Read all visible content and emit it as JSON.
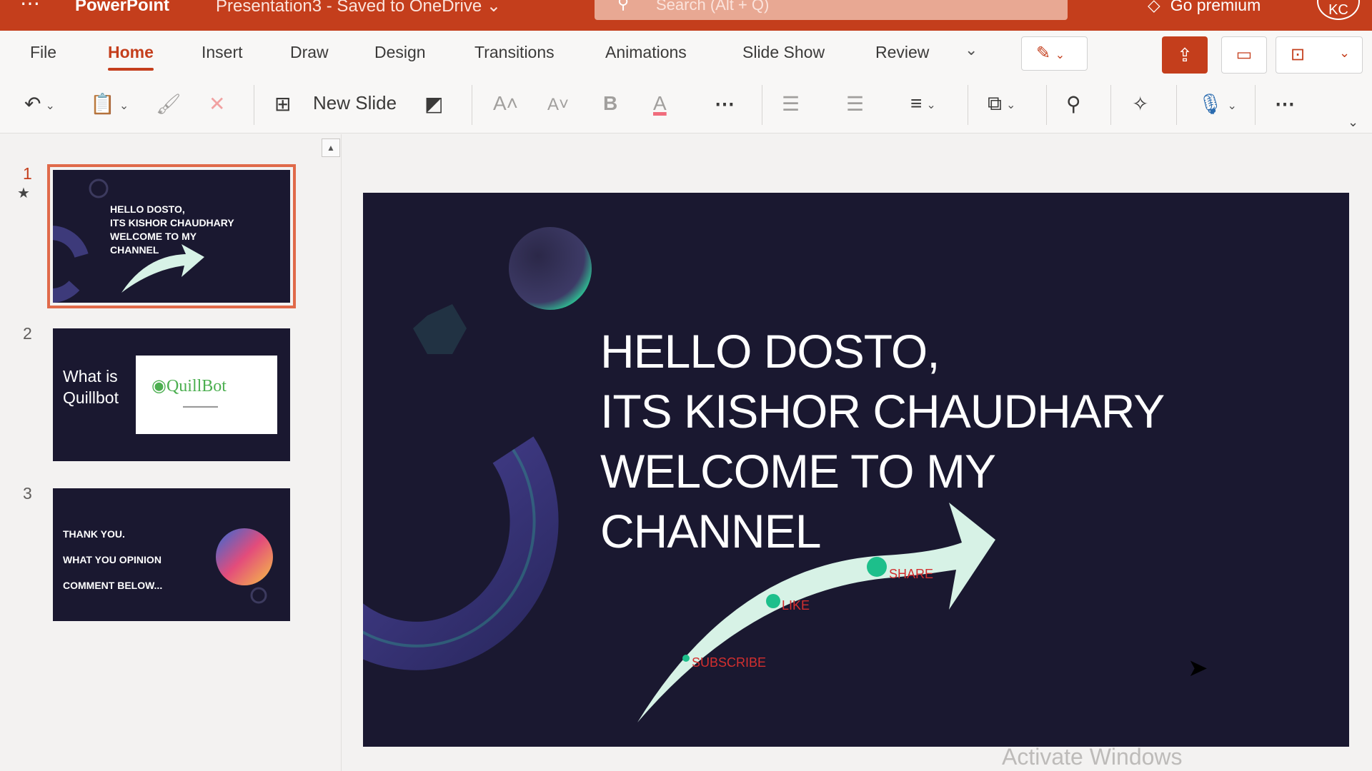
{
  "titlebar": {
    "app_name": "PowerPoint",
    "document_name": "Presentation3 - Saved to OneDrive",
    "search_placeholder": "Search (Alt + Q)",
    "go_premium": "Go premium",
    "avatar_initials": "KC"
  },
  "ribbon": {
    "tabs": [
      "File",
      "Home",
      "Insert",
      "Draw",
      "Design",
      "Transitions",
      "Animations",
      "Slide Show",
      "Review"
    ],
    "active_tab": "Home",
    "new_slide_label": "New Slide"
  },
  "thumbnails": [
    {
      "number": "1",
      "lines": [
        "HELLO DOSTO,",
        "ITS KISHOR CHAUDHARY",
        "WELCOME TO MY",
        "CHANNEL"
      ]
    },
    {
      "number": "2",
      "lines": [
        "What is",
        "Quillbot"
      ],
      "logo_text": "QuillBot"
    },
    {
      "number": "3",
      "lines": [
        "THANK YOU.",
        "WHAT YOU OPINION",
        "COMMENT BELOW..."
      ]
    }
  ],
  "slide": {
    "title_lines": [
      "HELLO DOSTO,",
      "ITS KISHOR CHAUDHARY",
      "WELCOME TO MY",
      "CHANNEL"
    ],
    "labels": {
      "subscribe": "SUBSCRIBE",
      "like": "LIKE",
      "share": "SHARE"
    }
  },
  "watermark": "Activate Windows",
  "colors": {
    "accent": "#c43e1c",
    "slide_bg": "#1a1830",
    "arrow": "#d7f2e6",
    "dot": "#1dbf8b"
  }
}
